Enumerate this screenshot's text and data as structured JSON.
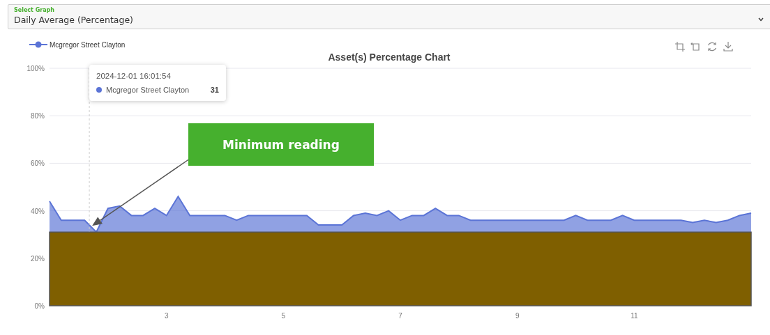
{
  "select_graph": {
    "label": "Select Graph",
    "value": "Daily Average (Percentage)"
  },
  "chart": {
    "toolbar": [
      {
        "kind": "zoom"
      },
      {
        "kind": "zoom_reset"
      },
      {
        "kind": "restore"
      },
      {
        "kind": "download"
      }
    ],
    "tooltip": {
      "title": "2024-12-01 16:01:54",
      "name": "Mcgregor Street Clayton",
      "value": "31",
      "color": "#5b74d6"
    },
    "chart_data": {
      "type": "area",
      "title": "Asset(s) Percentage Chart",
      "x": [
        1,
        1.2,
        1.4,
        1.6,
        1.8,
        2,
        2.2,
        2.4,
        2.6,
        2.8,
        3,
        3.2,
        3.4,
        3.6,
        3.8,
        4,
        4.2,
        4.4,
        4.6,
        4.8,
        5,
        5.2,
        5.4,
        5.6,
        5.8,
        6,
        6.2,
        6.4,
        6.6,
        6.8,
        7,
        7.2,
        7.4,
        7.6,
        7.8,
        8,
        8.2,
        8.4,
        8.6,
        8.8,
        9,
        9.2,
        9.4,
        9.6,
        9.8,
        10,
        10.2,
        10.4,
        10.6,
        10.8,
        11,
        11.2,
        11.4,
        11.6,
        11.8,
        12,
        12.2,
        12.4,
        12.6,
        12.8,
        13
      ],
      "series": [
        {
          "name": "Mcgregor Street Clayton",
          "color": "#5b74d6",
          "values": [
            44,
            36,
            36,
            36,
            31,
            41,
            42,
            38,
            38,
            41,
            38,
            46,
            38,
            38,
            38,
            38,
            36,
            38,
            38,
            38,
            38,
            38,
            38,
            34,
            34,
            34,
            38,
            39,
            38,
            40,
            36,
            38,
            38,
            41,
            38,
            38,
            36,
            36,
            36,
            36,
            36,
            36,
            36,
            36,
            36,
            38,
            36,
            36,
            36,
            38,
            36,
            36,
            36,
            36,
            36,
            35,
            36,
            35,
            36,
            38,
            39
          ]
        },
        {
          "color": "#7f5f00",
          "values": [
            31,
            31,
            31,
            31,
            31,
            31,
            31,
            31,
            31,
            31,
            31,
            31,
            31,
            31,
            31,
            31,
            31,
            31,
            31,
            31,
            31,
            31,
            31,
            31,
            31,
            31,
            31,
            31,
            31,
            31,
            31,
            31,
            31,
            31,
            31,
            31,
            31,
            31,
            31,
            31,
            31,
            31,
            31,
            31,
            31,
            31,
            31,
            31,
            31,
            31,
            31,
            31,
            31,
            31,
            31,
            31,
            31,
            31,
            31,
            31,
            31
          ]
        }
      ],
      "xlim": [
        1,
        13
      ],
      "ylim": [
        0,
        100
      ],
      "xticks": [
        3,
        5,
        7,
        9,
        11
      ],
      "yticks": [
        {
          "value": 0,
          "label": "0%"
        },
        {
          "value": 20,
          "label": "20%"
        },
        {
          "value": 40,
          "label": "40%"
        },
        {
          "value": 60,
          "label": "60%"
        },
        {
          "value": 80,
          "label": "80%"
        },
        {
          "value": 100,
          "label": "100%"
        }
      ],
      "grid": true,
      "annotations": [
        "Minimum reading"
      ]
    }
  }
}
